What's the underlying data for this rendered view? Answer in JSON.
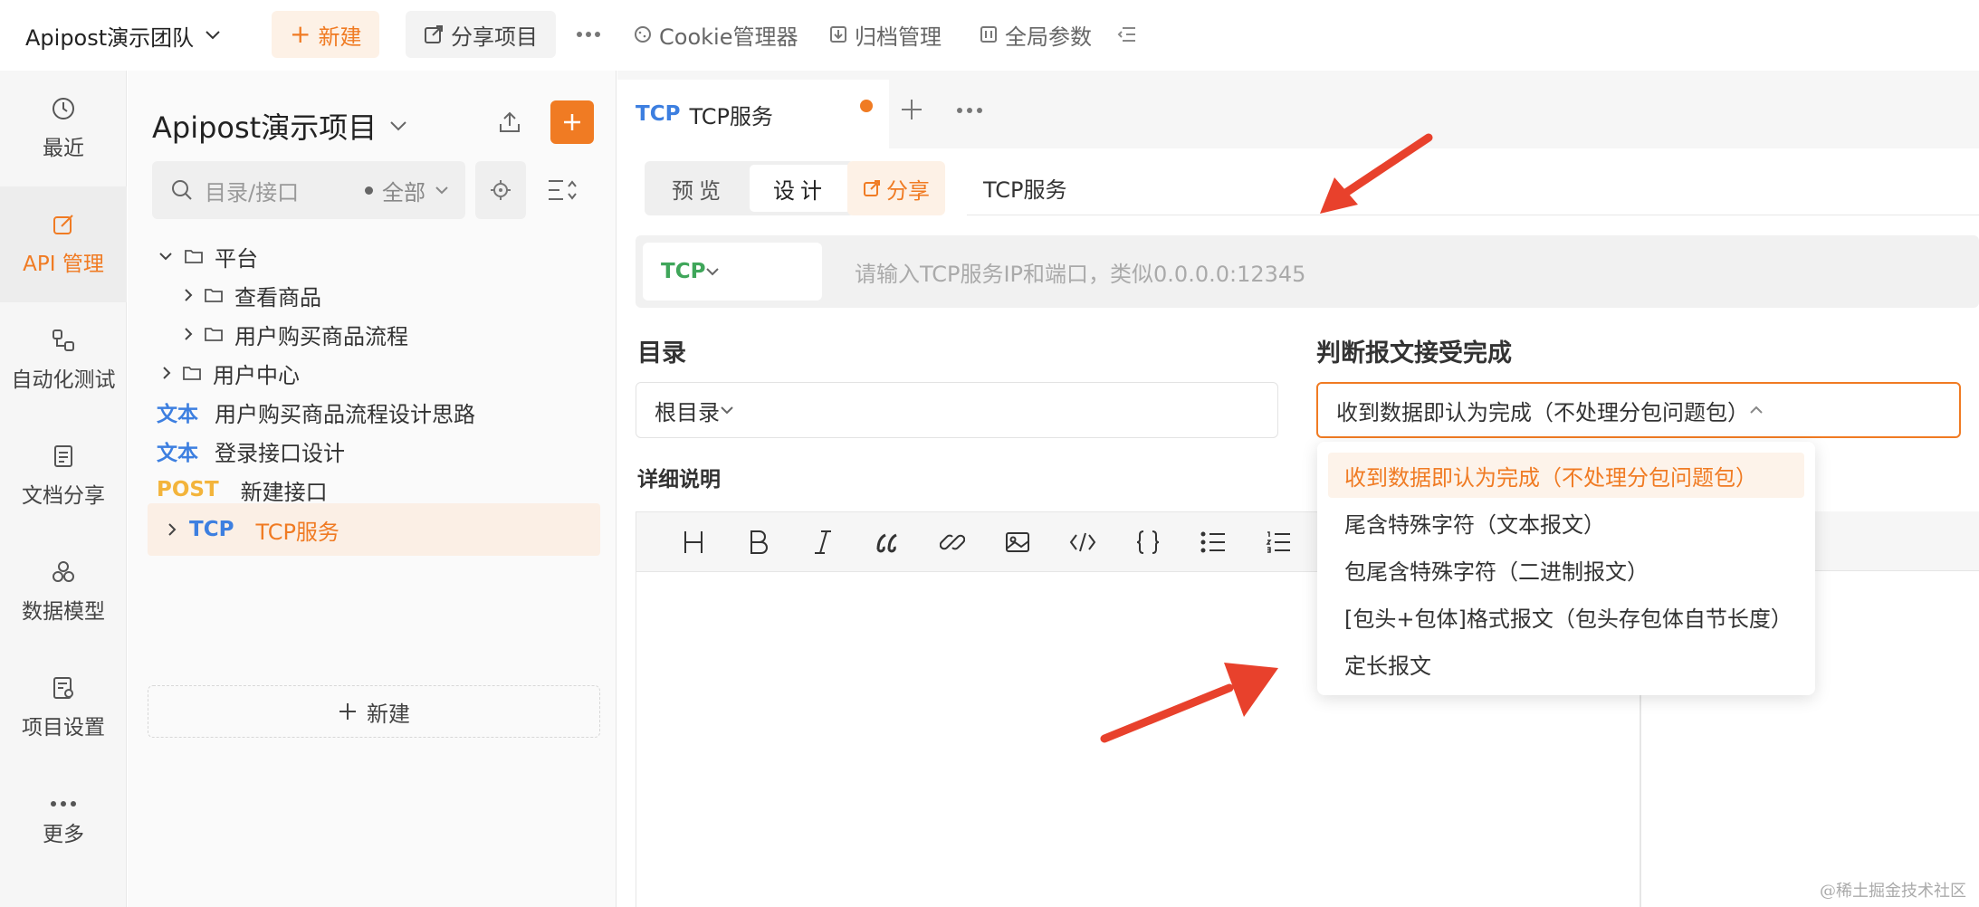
{
  "topbar": {
    "team_name": "Apipost演示团队",
    "new_label": "新建",
    "share_project_label": "分享项目",
    "cookie_label": "Cookie管理器",
    "archive_label": "归档管理",
    "global_params_label": "全局参数",
    "more_icon": "more-horizontal-icon"
  },
  "leftnav": {
    "items": [
      {
        "label": "最近",
        "icon": "clock-icon"
      },
      {
        "label": "API 管理",
        "icon": "edit-icon",
        "active": true
      },
      {
        "label": "自动化测试",
        "icon": "flow-icon"
      },
      {
        "label": "文档分享",
        "icon": "doc-icon"
      },
      {
        "label": "数据模型",
        "icon": "model-icon"
      },
      {
        "label": "项目设置",
        "icon": "settings-doc-icon"
      },
      {
        "label": "更多",
        "icon": "more-icon"
      }
    ]
  },
  "tree": {
    "project_title": "Apipost演示项目",
    "search_placeholder": "目录/接口",
    "filter_label": "全部",
    "items": [
      {
        "type": "folder",
        "label": "平台",
        "expanded": true
      },
      {
        "type": "folder",
        "label": "查看商品"
      },
      {
        "type": "folder",
        "label": "用户购买商品流程"
      },
      {
        "type": "folder",
        "label": "用户中心"
      },
      {
        "type": "doc",
        "tag": "文本",
        "label": "用户购买商品流程设计思路"
      },
      {
        "type": "doc",
        "tag": "文本",
        "label": "登录接口设计"
      },
      {
        "type": "api",
        "tag": "POST",
        "label": "新建接口"
      },
      {
        "type": "api",
        "tag": "TCP",
        "label": "TCP服务",
        "selected": true
      }
    ],
    "new_label": "新建"
  },
  "main": {
    "tab": {
      "tag": "TCP",
      "title": "TCP服务",
      "unsaved": true
    },
    "mode": {
      "preview": "预览",
      "design": "设计",
      "active": "design"
    },
    "share_label": "分享",
    "name_value": "TCP服务",
    "protocol": "TCP",
    "url_placeholder": "请输入TCP服务IP和端口，类似0.0.0.0:12345",
    "dir_label": "目录",
    "dir_value": "根目录",
    "judge_label": "判断报文接受完成",
    "judge_value": "收到数据即认为完成（不处理分包问题包）",
    "desc_label": "详细说明",
    "toolbar": [
      "H",
      "B",
      "I",
      "quote",
      "link",
      "image",
      "code",
      "braces",
      "ul",
      "ol"
    ],
    "dropdown_options": [
      "收到数据即认为完成（不处理分包问题包）",
      "尾含特殊字符（文本报文）",
      "包尾含特殊字符（二进制报文）",
      "[包头+包体]格式报文（包头存包体自节长度）",
      "定长报文"
    ],
    "selected_option_index": 0
  },
  "colors": {
    "accent": "#f07b23",
    "tcp_blue": "#3d7fe0",
    "post_yellow": "#f3b43b",
    "tcp_green": "#3fa65a",
    "arrow_red": "#e8412c"
  },
  "watermark": "@稀土掘金技术社区"
}
